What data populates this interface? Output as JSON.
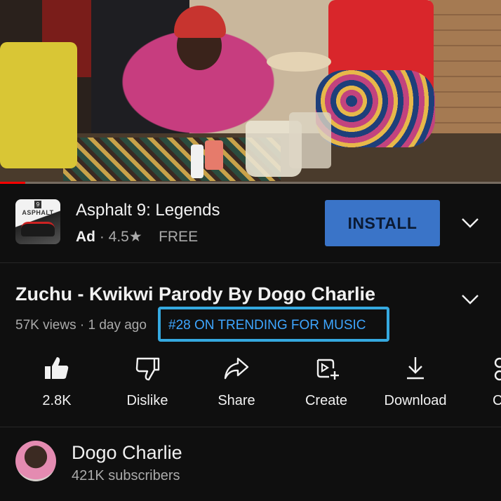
{
  "ad": {
    "app_icon_brand": "ASPHALT",
    "app_icon_number": "9",
    "title": "Asphalt 9: Legends",
    "ad_label": "Ad",
    "rating": "4.5★",
    "price": "FREE",
    "install_label": "INSTALL"
  },
  "video": {
    "title": "Zuchu - Kwikwi Parody By Dogo Charlie",
    "stats": "57K views · 1 day ago",
    "trending": "#28 ON TRENDING FOR MUSIC",
    "progress_fraction": 0.05
  },
  "actions": [
    {
      "label": "2.8K",
      "icon": "thumbs-up-icon"
    },
    {
      "label": "Dislike",
      "icon": "thumbs-down-icon"
    },
    {
      "label": "Share",
      "icon": "share-icon"
    },
    {
      "label": "Create",
      "icon": "create-icon"
    },
    {
      "label": "Download",
      "icon": "download-icon"
    },
    {
      "label": "C",
      "icon": "clip-icon"
    }
  ],
  "channel": {
    "name": "Dogo Charlie",
    "subscribers": "421K subscribers"
  },
  "colors": {
    "background": "#0f0f0f",
    "install_button": "#3a74c8",
    "trending_highlight": "#35a9e0",
    "link_blue": "#3ea6ff",
    "progress_red": "#ff0000"
  }
}
